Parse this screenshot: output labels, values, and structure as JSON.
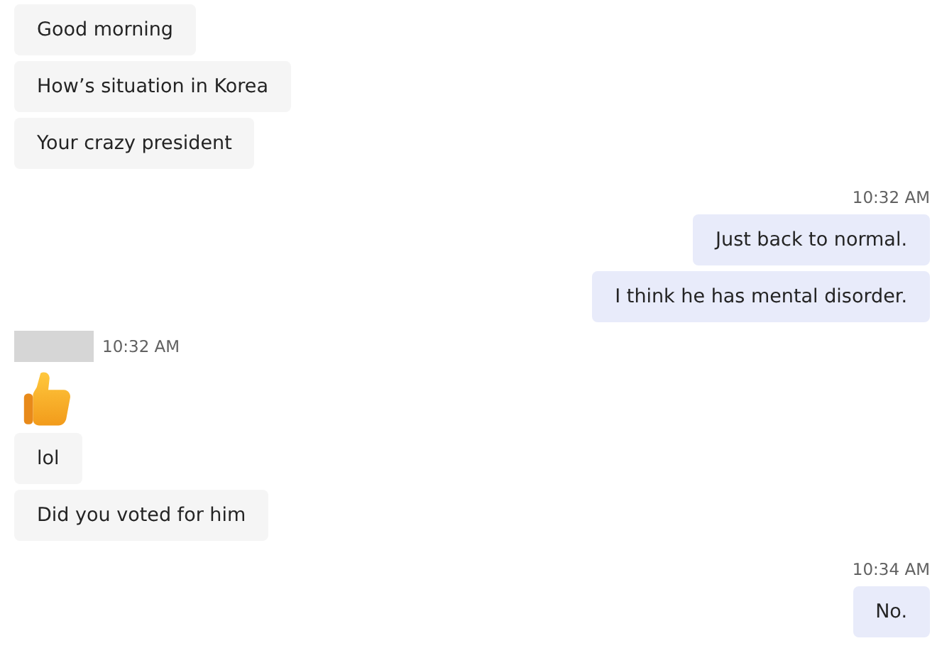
{
  "messages": [
    {
      "kind": "received",
      "text": "Good morning"
    },
    {
      "kind": "received",
      "text": "How’s situation in Korea"
    },
    {
      "kind": "received",
      "text": "Your crazy president"
    },
    {
      "kind": "time",
      "text": "10:32 AM"
    },
    {
      "kind": "sent",
      "text": "Just back to normal."
    },
    {
      "kind": "sent",
      "text": "I think he has mental disorder."
    },
    {
      "kind": "sender",
      "text": "10:32 AM"
    },
    {
      "kind": "emoji"
    },
    {
      "kind": "received",
      "text": "lol"
    },
    {
      "kind": "received",
      "text": "Did you voted for him"
    },
    {
      "kind": "time",
      "text": "10:34 AM"
    },
    {
      "kind": "sent",
      "text": "No."
    }
  ]
}
